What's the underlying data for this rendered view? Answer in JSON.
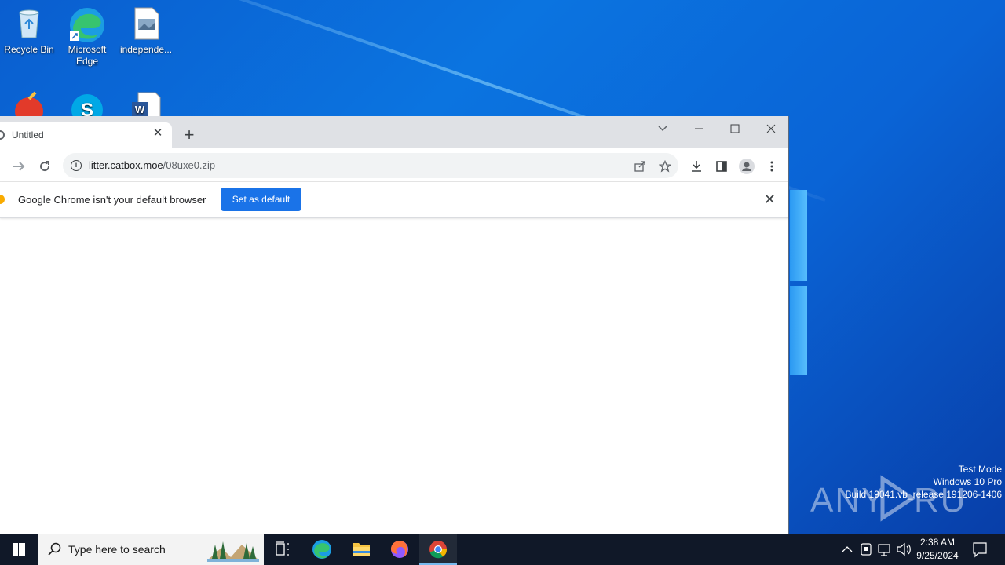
{
  "desktop": {
    "icons": [
      {
        "label": "Recycle Bin"
      },
      {
        "label": "Microsoft Edge"
      },
      {
        "label": "independe..."
      }
    ]
  },
  "watermark": {
    "brand": "ANY RUN",
    "line1": "Test Mode",
    "line2": "Windows 10 Pro",
    "line3": "Build 19041.vb_release.191206-1406"
  },
  "browser": {
    "tab_title": "Untitled",
    "url_host": "litter.catbox.moe",
    "url_path": "/08uxe0.zip",
    "infobar_message": "Google Chrome isn't your default browser",
    "infobar_button": "Set as default"
  },
  "taskbar": {
    "search_placeholder": "Type here to search",
    "time": "2:38 AM",
    "date": "9/25/2024"
  },
  "colors": {
    "desktop_blue": "#0b74e0",
    "chrome_tabstrip": "#dfe1e5",
    "default_button": "#1a73e8",
    "taskbar": "#101828"
  }
}
